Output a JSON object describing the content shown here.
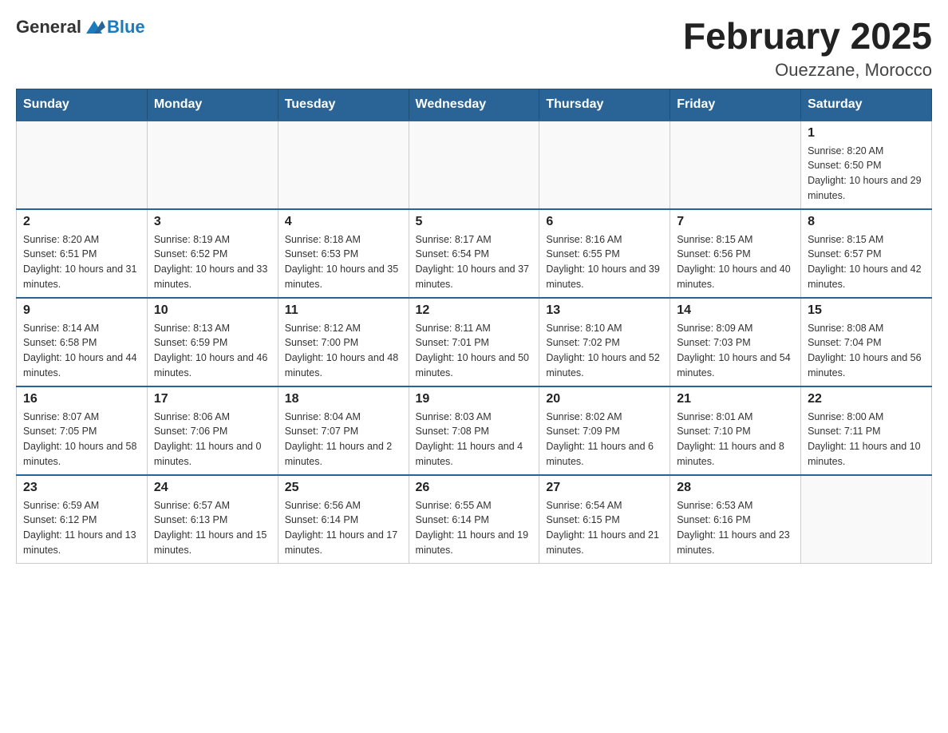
{
  "header": {
    "logo_general": "General",
    "logo_blue": "Blue",
    "title": "February 2025",
    "subtitle": "Ouezzane, Morocco"
  },
  "days_of_week": [
    "Sunday",
    "Monday",
    "Tuesday",
    "Wednesday",
    "Thursday",
    "Friday",
    "Saturday"
  ],
  "weeks": [
    [
      {
        "day": "",
        "info": ""
      },
      {
        "day": "",
        "info": ""
      },
      {
        "day": "",
        "info": ""
      },
      {
        "day": "",
        "info": ""
      },
      {
        "day": "",
        "info": ""
      },
      {
        "day": "",
        "info": ""
      },
      {
        "day": "1",
        "info": "Sunrise: 8:20 AM\nSunset: 6:50 PM\nDaylight: 10 hours and 29 minutes."
      }
    ],
    [
      {
        "day": "2",
        "info": "Sunrise: 8:20 AM\nSunset: 6:51 PM\nDaylight: 10 hours and 31 minutes."
      },
      {
        "day": "3",
        "info": "Sunrise: 8:19 AM\nSunset: 6:52 PM\nDaylight: 10 hours and 33 minutes."
      },
      {
        "day": "4",
        "info": "Sunrise: 8:18 AM\nSunset: 6:53 PM\nDaylight: 10 hours and 35 minutes."
      },
      {
        "day": "5",
        "info": "Sunrise: 8:17 AM\nSunset: 6:54 PM\nDaylight: 10 hours and 37 minutes."
      },
      {
        "day": "6",
        "info": "Sunrise: 8:16 AM\nSunset: 6:55 PM\nDaylight: 10 hours and 39 minutes."
      },
      {
        "day": "7",
        "info": "Sunrise: 8:15 AM\nSunset: 6:56 PM\nDaylight: 10 hours and 40 minutes."
      },
      {
        "day": "8",
        "info": "Sunrise: 8:15 AM\nSunset: 6:57 PM\nDaylight: 10 hours and 42 minutes."
      }
    ],
    [
      {
        "day": "9",
        "info": "Sunrise: 8:14 AM\nSunset: 6:58 PM\nDaylight: 10 hours and 44 minutes."
      },
      {
        "day": "10",
        "info": "Sunrise: 8:13 AM\nSunset: 6:59 PM\nDaylight: 10 hours and 46 minutes."
      },
      {
        "day": "11",
        "info": "Sunrise: 8:12 AM\nSunset: 7:00 PM\nDaylight: 10 hours and 48 minutes."
      },
      {
        "day": "12",
        "info": "Sunrise: 8:11 AM\nSunset: 7:01 PM\nDaylight: 10 hours and 50 minutes."
      },
      {
        "day": "13",
        "info": "Sunrise: 8:10 AM\nSunset: 7:02 PM\nDaylight: 10 hours and 52 minutes."
      },
      {
        "day": "14",
        "info": "Sunrise: 8:09 AM\nSunset: 7:03 PM\nDaylight: 10 hours and 54 minutes."
      },
      {
        "day": "15",
        "info": "Sunrise: 8:08 AM\nSunset: 7:04 PM\nDaylight: 10 hours and 56 minutes."
      }
    ],
    [
      {
        "day": "16",
        "info": "Sunrise: 8:07 AM\nSunset: 7:05 PM\nDaylight: 10 hours and 58 minutes."
      },
      {
        "day": "17",
        "info": "Sunrise: 8:06 AM\nSunset: 7:06 PM\nDaylight: 11 hours and 0 minutes."
      },
      {
        "day": "18",
        "info": "Sunrise: 8:04 AM\nSunset: 7:07 PM\nDaylight: 11 hours and 2 minutes."
      },
      {
        "day": "19",
        "info": "Sunrise: 8:03 AM\nSunset: 7:08 PM\nDaylight: 11 hours and 4 minutes."
      },
      {
        "day": "20",
        "info": "Sunrise: 8:02 AM\nSunset: 7:09 PM\nDaylight: 11 hours and 6 minutes."
      },
      {
        "day": "21",
        "info": "Sunrise: 8:01 AM\nSunset: 7:10 PM\nDaylight: 11 hours and 8 minutes."
      },
      {
        "day": "22",
        "info": "Sunrise: 8:00 AM\nSunset: 7:11 PM\nDaylight: 11 hours and 10 minutes."
      }
    ],
    [
      {
        "day": "23",
        "info": "Sunrise: 6:59 AM\nSunset: 6:12 PM\nDaylight: 11 hours and 13 minutes."
      },
      {
        "day": "24",
        "info": "Sunrise: 6:57 AM\nSunset: 6:13 PM\nDaylight: 11 hours and 15 minutes."
      },
      {
        "day": "25",
        "info": "Sunrise: 6:56 AM\nSunset: 6:14 PM\nDaylight: 11 hours and 17 minutes."
      },
      {
        "day": "26",
        "info": "Sunrise: 6:55 AM\nSunset: 6:14 PM\nDaylight: 11 hours and 19 minutes."
      },
      {
        "day": "27",
        "info": "Sunrise: 6:54 AM\nSunset: 6:15 PM\nDaylight: 11 hours and 21 minutes."
      },
      {
        "day": "28",
        "info": "Sunrise: 6:53 AM\nSunset: 6:16 PM\nDaylight: 11 hours and 23 minutes."
      },
      {
        "day": "",
        "info": ""
      }
    ]
  ]
}
